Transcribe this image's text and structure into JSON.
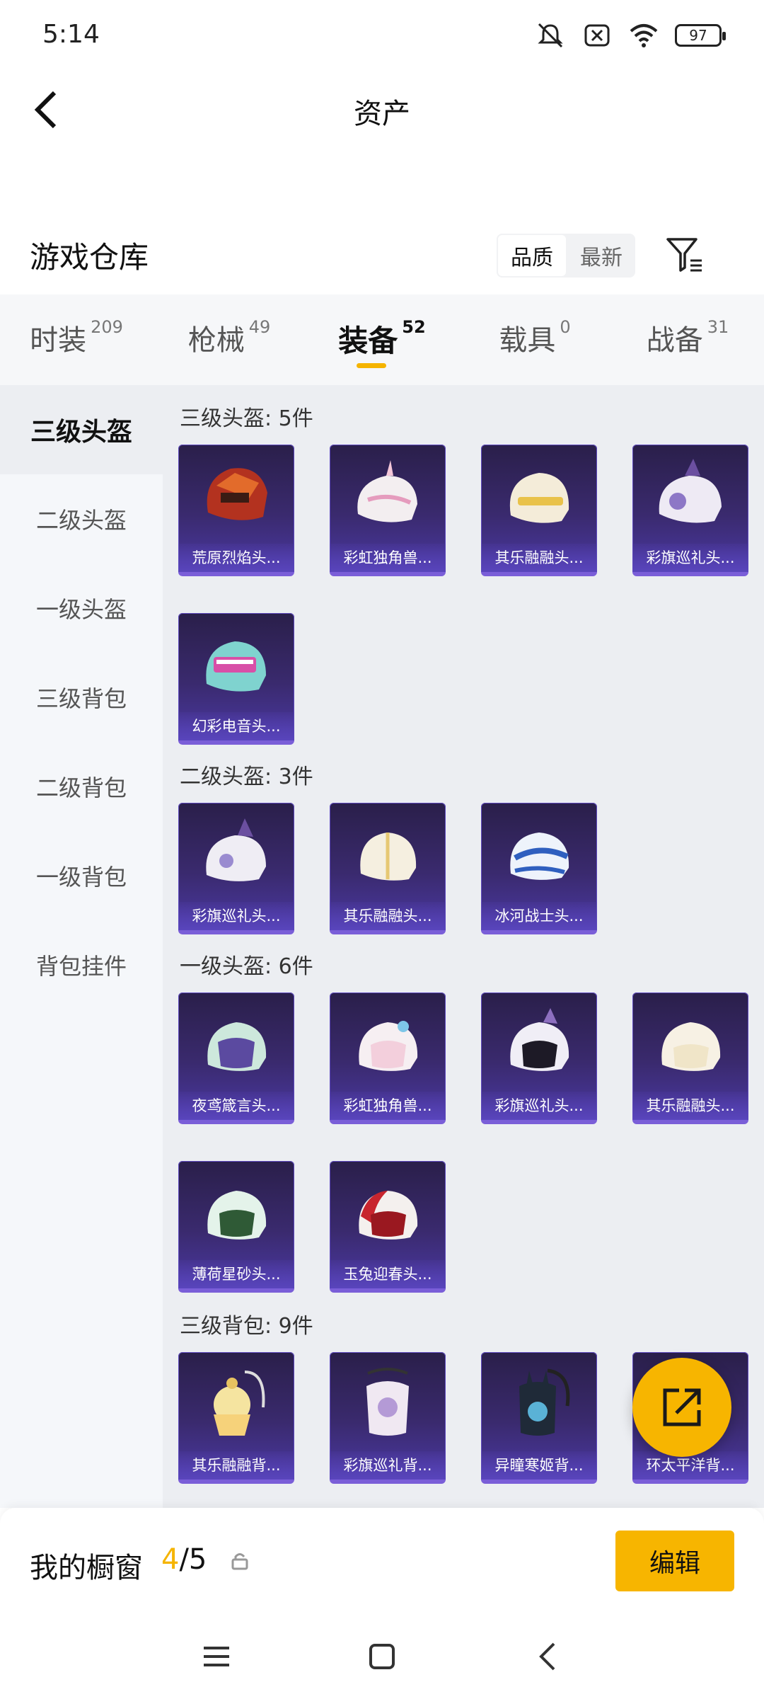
{
  "status": {
    "time": "5:14",
    "battery": "97"
  },
  "header": {
    "title": "资产"
  },
  "warehouse": {
    "title": "游戏仓库",
    "sort_quality": "品质",
    "sort_newest": "最新"
  },
  "tabs": [
    {
      "label": "时装",
      "count": "209"
    },
    {
      "label": "枪械",
      "count": "49"
    },
    {
      "label": "装备",
      "count": "52"
    },
    {
      "label": "载具",
      "count": "0"
    },
    {
      "label": "战备",
      "count": "31"
    }
  ],
  "sidebar": [
    {
      "label": "三级头盔"
    },
    {
      "label": "二级头盔"
    },
    {
      "label": "一级头盔"
    },
    {
      "label": "三级背包"
    },
    {
      "label": "二级背包"
    },
    {
      "label": "一级背包"
    },
    {
      "label": "背包挂件"
    }
  ],
  "groups": [
    {
      "title": "三级头盔: 5件",
      "items": [
        "荒原烈焰头...",
        "彩虹独角兽...",
        "其乐融融头...",
        "彩旗巡礼头...",
        "幻彩电音头..."
      ]
    },
    {
      "title": "二级头盔: 3件",
      "items": [
        "彩旗巡礼头...",
        "其乐融融头...",
        "冰河战士头..."
      ]
    },
    {
      "title": "一级头盔: 6件",
      "items": [
        "夜鸢箴言头...",
        "彩虹独角兽...",
        "彩旗巡礼头...",
        "其乐融融头...",
        "薄荷星砂头...",
        "玉兔迎春头..."
      ]
    },
    {
      "title": "三级背包: 9件",
      "items": [
        "其乐融融背...",
        "彩旗巡礼背...",
        "异瞳寒姬背...",
        "环太平洋背..."
      ]
    }
  ],
  "showcase": {
    "title": "我的橱窗",
    "current": "4",
    "total": "/5",
    "edit_label": "编辑"
  },
  "colors": {
    "accent": "#f7b500",
    "card_bg": "#3a2a6e",
    "card_border": "#7a5ed8"
  }
}
